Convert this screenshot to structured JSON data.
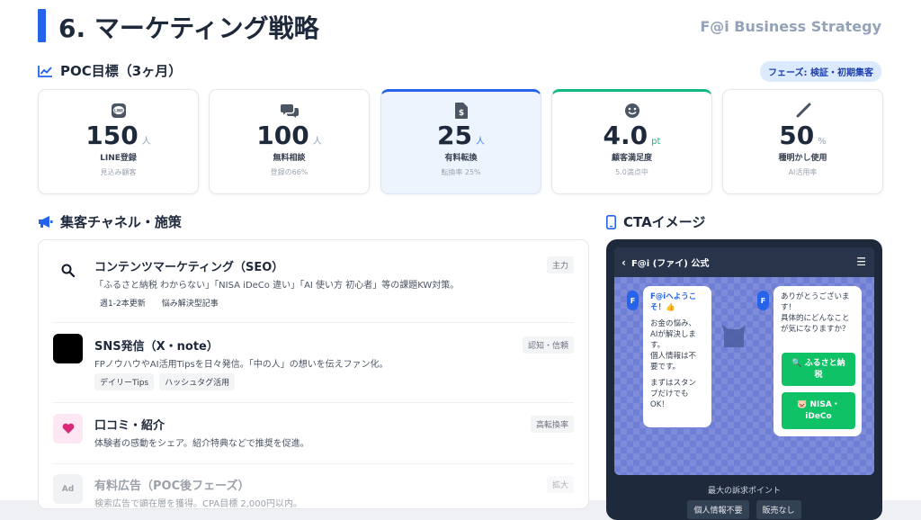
{
  "header": {
    "title": "6. マーケティング戦略",
    "brand": "F@i Business Strategy"
  },
  "poc": {
    "heading": "POC目標（3ヶ月）",
    "phase_badge": "フェーズ: 検証・初期集客",
    "kpis": [
      {
        "icon": "line-icon",
        "value": "150",
        "unit": "人",
        "label": "LINE登録",
        "sub": "見込み顧客"
      },
      {
        "icon": "chat-bubbles-icon",
        "value": "100",
        "unit": "人",
        "label": "無料相談",
        "sub": "登録の66%"
      },
      {
        "icon": "file-invoice-dollar-icon",
        "value": "25",
        "unit": "人",
        "label": "有料転換",
        "sub": "転換率 25%"
      },
      {
        "icon": "smile-icon",
        "value": "4.0",
        "unit": "pt",
        "label": "顧客満足度",
        "sub": "5.0満点中"
      },
      {
        "icon": "magic-wand-icon",
        "value": "50",
        "unit": "%",
        "label": "種明かし使用",
        "sub": "AI活用率"
      }
    ]
  },
  "channels": {
    "heading": "集客チャネル・施策",
    "items": [
      {
        "icon": "search-icon",
        "title": "コンテンツマーケティング（SEO）",
        "desc": "「ふるさと納税 わからない」「NISA iDeCo 違い」「AI 使い方 初心者」等の課題KW対策。",
        "tag": "主力",
        "chips": [
          "週1-2本更新",
          "悩み解決型記事"
        ]
      },
      {
        "icon": "x-logo-icon",
        "title": "SNS発信（X・note）",
        "desc": "FPノウハウやAI活用Tipsを日々発信。「中の人」の想いを伝えファン化。",
        "tag": "認知・信頼",
        "chips": [
          "デイリーTips",
          "ハッシュタグ活用"
        ]
      },
      {
        "icon": "heart-icon",
        "title": "口コミ・紹介",
        "desc": "体験者の感動をシェア。紹介特典などで推奨を促進。",
        "tag": "高転換率",
        "chips": []
      },
      {
        "icon": "ad-icon",
        "title": "有料広告（POC後フェーズ）",
        "desc": "検索広告で顕在層を獲得。CPA目標 2,000円以内。",
        "tag": "拡大",
        "chips": []
      }
    ]
  },
  "cta": {
    "heading": "CTAイメージ",
    "chat_title": "F@i (ファイ) 公式",
    "avatar_letter": "F",
    "bubble_left": {
      "greeting": "F@iへようこそ！👍",
      "lines": [
        "お金の悩み、",
        "AIが解決しま",
        "す。",
        "個人情報は不",
        "要です。"
      ],
      "lines2": [
        "まずはスタン",
        "プだけでも",
        "OK！"
      ]
    },
    "bubble_right": {
      "lines": [
        "ありがとうございま",
        "す！",
        "具体的にどんなこと",
        "が気になりますか？"
      ]
    },
    "buttons": [
      {
        "line1": "🔍 ふるさと納",
        "line2": "税"
      },
      {
        "line1": "🐷 NISA・",
        "line2": "iDeCo"
      }
    ],
    "footer_title": "最大の訴求ポイント",
    "footer_chips": [
      "個人情報不要",
      "販売なし"
    ]
  },
  "colors": {
    "accent": "#2563eb",
    "green": "#10b981",
    "line_green": "#10c266"
  }
}
